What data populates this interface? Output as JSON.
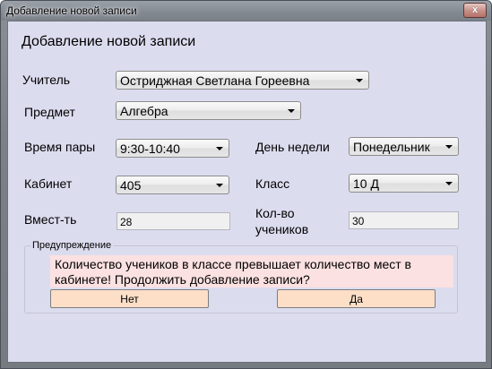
{
  "window": {
    "title": "Добавление новой записи",
    "close_glyph": "x"
  },
  "form": {
    "heading": "Добавление новой записи",
    "teacher_label": "Учитель",
    "teacher_value": "Остриджная Светлана Гореевна",
    "subject_label": "Предмет",
    "subject_value": "Алгебра",
    "time_label": "Время пары",
    "time_value": "9:30-10:40",
    "weekday_label": "День недели",
    "weekday_value": "Понедельник",
    "room_label": "Кабинет",
    "room_value": "405",
    "class_label": "Класс",
    "class_value": "10 Д",
    "capacity_label": "Вмест-ть",
    "capacity_value": "28",
    "students_label_line1": "Кол-во",
    "students_label_line2": "учеников",
    "students_value": "30"
  },
  "warning": {
    "legend": "Предупреждение",
    "message_line1": "Количество учеников в классе превышает количество мест в",
    "message_line2": "кабинете! Продолжить добавление записи?",
    "no_label": "Нет",
    "yes_label": "Да"
  },
  "icons": {
    "dropdown": "chevron-down-icon",
    "close": "close-icon"
  },
  "colors": {
    "client_bg": "#dcdcef",
    "warning_bg": "#fbe1e1",
    "button_bg": "#fddfc8"
  }
}
